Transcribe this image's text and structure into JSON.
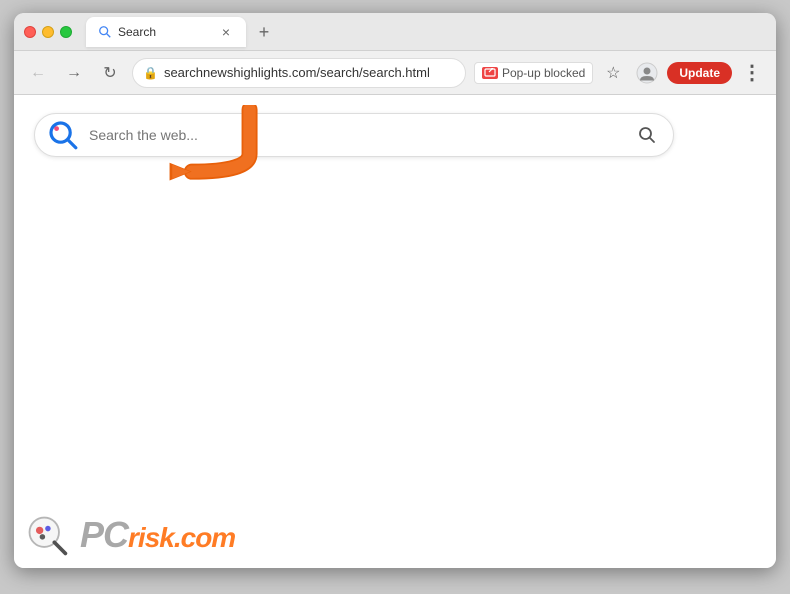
{
  "browser": {
    "tab": {
      "title": "Search",
      "close_label": "×"
    },
    "new_tab_label": "+",
    "address_bar": {
      "url": "searchnewshighlights.com/search/search.html",
      "lock_icon": "🔒"
    },
    "popup_blocked": {
      "label": "Pop-up blocked"
    },
    "update_button": "Update",
    "more_menu": "⋮"
  },
  "page": {
    "search_placeholder": "Search the web...",
    "search_logo_alt": "search-logo",
    "search_icon": "🔍"
  },
  "watermark": {
    "text_pc": "PC",
    "text_risk": "risk",
    "text_dot": ".",
    "text_com": "com"
  },
  "colors": {
    "search_logo_blue": "#1a73e8",
    "tab_close": "#666",
    "update_btn_red": "#d93025",
    "orange_arrow": "#e8600a",
    "watermark_pc": "#999",
    "watermark_risk": "#ff6600"
  }
}
